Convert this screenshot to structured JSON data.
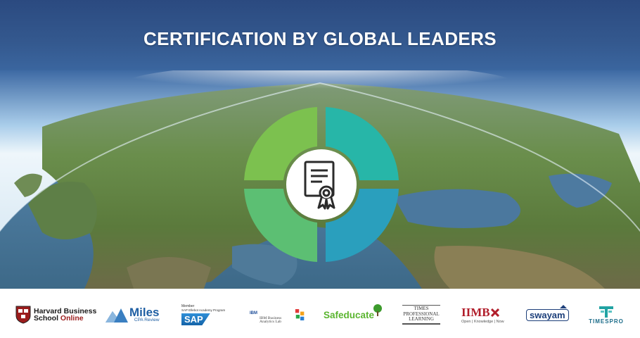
{
  "banner": {
    "title": "CERTIFICATION BY GLOBAL LEADERS",
    "center_icon": "certificate-icon",
    "ring_colors": [
      "#7cc14f",
      "#27b6a8",
      "#5cbf73",
      "#2a9fbd"
    ]
  },
  "partners": {
    "harvard": {
      "line1": "Harvard Business",
      "line2a": "School ",
      "line2b": "Online"
    },
    "miles": {
      "name": "Miles",
      "sub": "CPA Review"
    },
    "sap": {
      "member": "Member",
      "program": "SAP Ellebot Academy Program",
      "name": "SAP"
    },
    "ibm": {
      "name": "IBM",
      "lab": "IBM Business Analytics Lab"
    },
    "safeducate": {
      "name": "Safeducate"
    },
    "times": {
      "line1": "TIMES",
      "line2": "PROFESSIONAL",
      "line3": "LEARNING"
    },
    "iimb": {
      "name": "IIMB",
      "tagline": "Open | Knowledge | Now"
    },
    "swayam": {
      "name": "swayam"
    },
    "timespro": {
      "name": "TIMESPRO"
    }
  }
}
